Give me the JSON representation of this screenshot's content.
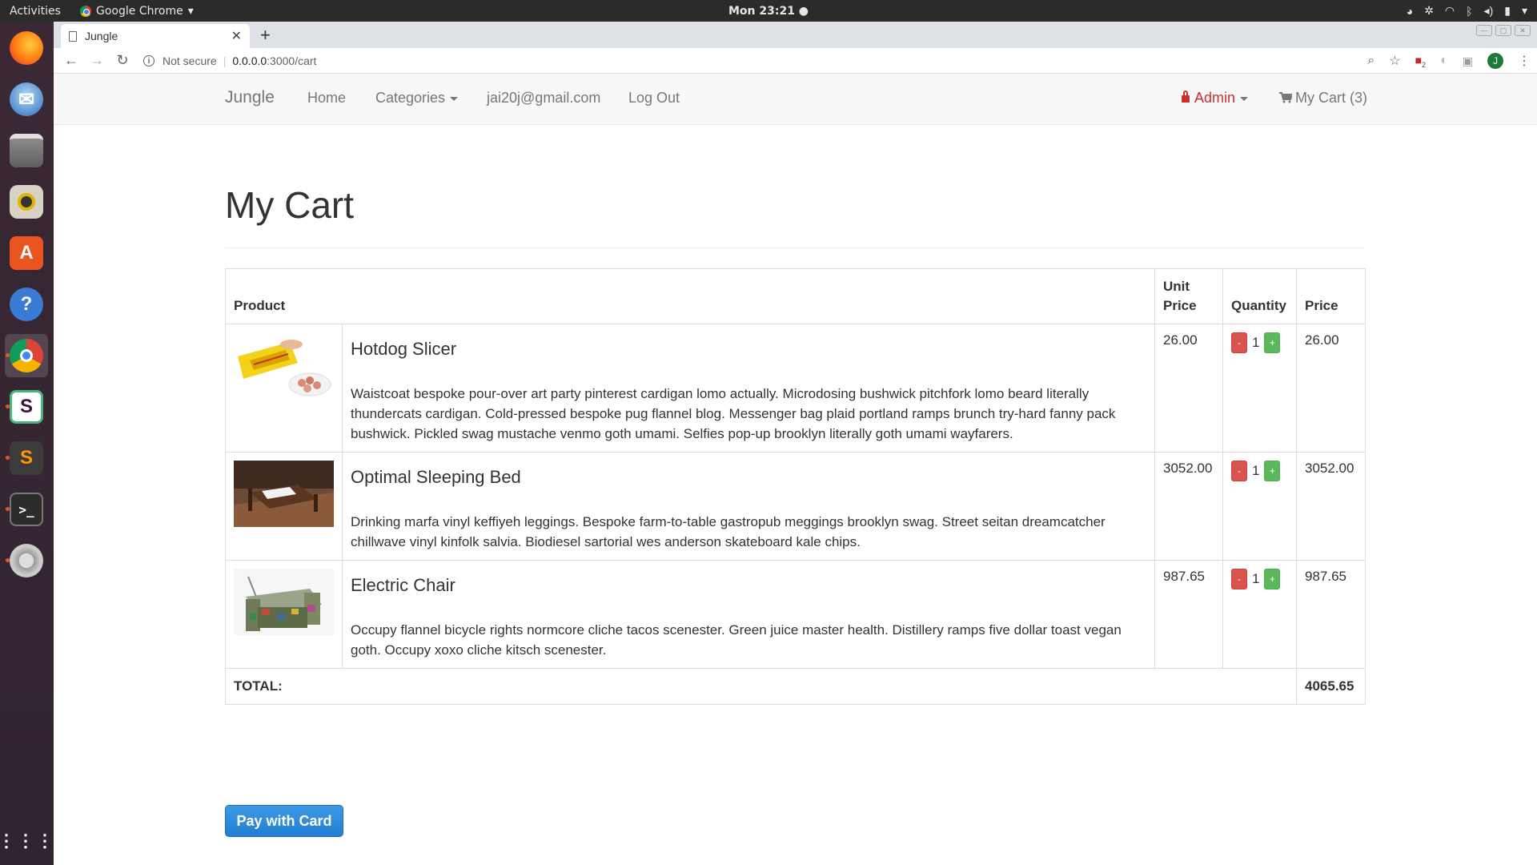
{
  "os": {
    "activities": "Activities",
    "app_name": "Google Chrome",
    "clock": "Mon 23:21 ●"
  },
  "browser": {
    "tab_title": "Jungle",
    "not_secure": "Not secure",
    "url_host": "0.0.0.0",
    "url_path": ":3000/cart",
    "ext_badge": "2",
    "avatar_letter": "J"
  },
  "navbar": {
    "brand": "Jungle",
    "home": "Home",
    "categories": "Categories",
    "email": "jai20j@gmail.com",
    "logout": "Log Out",
    "admin": "Admin",
    "cart": "My Cart (3)"
  },
  "page": {
    "title": "My Cart"
  },
  "table": {
    "headers": {
      "product": "Product",
      "unit_price": "Unit Price",
      "quantity": "Quantity",
      "price": "Price"
    },
    "rows": [
      {
        "name": "Hotdog Slicer",
        "description": "Waistcoat bespoke pour-over art party pinterest cardigan lomo actually. Microdosing bushwick pitchfork lomo beard literally thundercats cardigan. Cold-pressed bespoke pug flannel blog. Messenger bag plaid portland ramps brunch try-hard fanny pack bushwick. Pickled swag mustache venmo goth umami. Selfies pop-up brooklyn literally goth umami wayfarers.",
        "unit_price": "26.00",
        "quantity": "1",
        "price": "26.00"
      },
      {
        "name": "Optimal Sleeping Bed",
        "description": "Drinking marfa vinyl keffiyeh leggings. Bespoke farm-to-table gastropub meggings brooklyn swag. Street seitan dreamcatcher chillwave vinyl kinfolk salvia. Biodiesel sartorial wes anderson skateboard kale chips.",
        "unit_price": "3052.00",
        "quantity": "1",
        "price": "3052.00"
      },
      {
        "name": "Electric Chair",
        "description": "Occupy flannel bicycle rights normcore cliche tacos scenester. Green juice master health. Distillery ramps five dollar toast vegan goth. Occupy xoxo cliche kitsch scenester.",
        "unit_price": "987.65",
        "quantity": "1",
        "price": "987.65"
      }
    ],
    "minus_label": "-",
    "plus_label": "+",
    "total_label": "TOTAL:",
    "total_value": "4065.65"
  },
  "pay_button": "Pay with Card",
  "colors": {
    "danger": "#d9534f",
    "success": "#5cb85c",
    "primary": "#2385d6",
    "admin": "#c9302c"
  }
}
